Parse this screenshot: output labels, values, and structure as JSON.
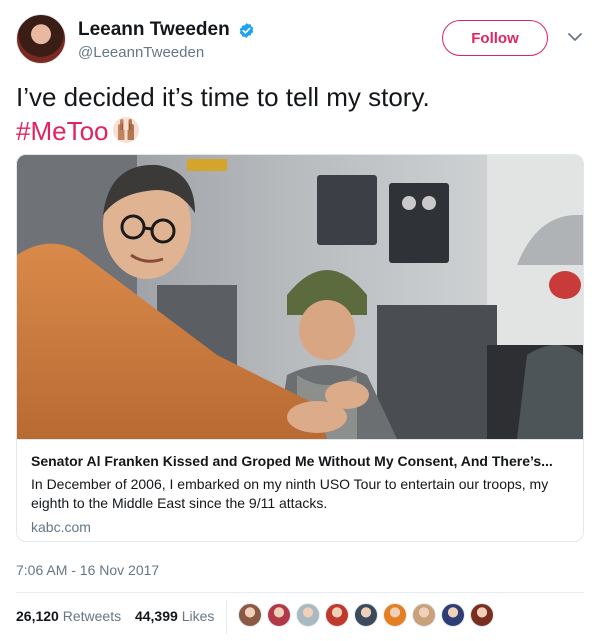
{
  "user": {
    "display_name": "Leeann Tweeden",
    "handle": "@LeeannTweeden",
    "verified": true,
    "avatar_icon": "profile-avatar"
  },
  "follow_label": "Follow",
  "menu_icon": "chevron-down-icon",
  "tweet": {
    "text_line1": "I’ve decided it’s time to tell my story.",
    "hashtag": "#MeToo",
    "emoji": "raised-hands-emoji"
  },
  "card": {
    "title": "Senator Al Franken Kissed and Groped Me Without My Consent, And There’s...",
    "description": "In December of 2006, I embarked on my ninth USO Tour to entertain our troops, my eighth to the Middle East since the 9/11 attacks.",
    "domain": "kabc.com"
  },
  "timestamp": "7:06 AM - 16 Nov 2017",
  "stats": {
    "retweets_count": "26,120",
    "retweets_label": "Retweets",
    "likes_count": "44,399",
    "likes_label": "Likes"
  },
  "likers": [
    {
      "color": "#8a5a44"
    },
    {
      "color": "#b23a48"
    },
    {
      "color": "#aab8c2"
    },
    {
      "color": "#c0392b"
    },
    {
      "color": "#3b4a5c"
    },
    {
      "color": "#e67e22"
    },
    {
      "color": "#c9a27c"
    },
    {
      "color": "#2c3e75"
    },
    {
      "color": "#7a2e1f"
    }
  ],
  "colors": {
    "accent": "#e0245e",
    "verified": "#1da1f2",
    "secondary_text": "#657786"
  }
}
